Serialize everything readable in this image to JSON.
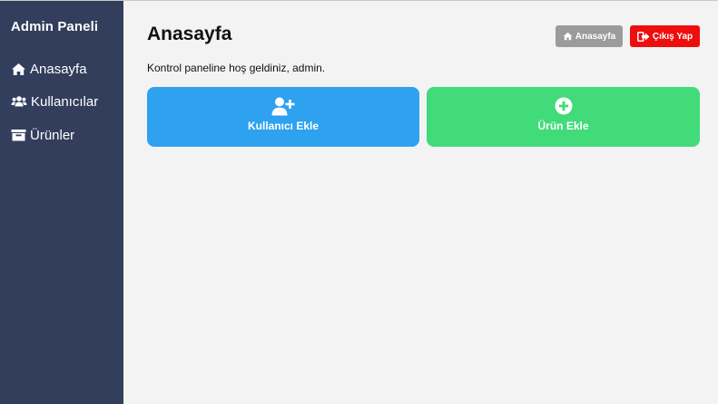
{
  "sidebar": {
    "brand": "Admin Paneli",
    "items": [
      {
        "label": "Anasayfa",
        "icon": "home-icon"
      },
      {
        "label": "Kullanıcılar",
        "icon": "users-icon"
      },
      {
        "label": "Ürünler",
        "icon": "box-icon"
      }
    ]
  },
  "header": {
    "title": "Anasayfa",
    "home_button": {
      "label": "Anasayfa",
      "icon": "home-icon"
    },
    "logout_button": {
      "label": "Çıkış Yap",
      "icon": "sign-out-icon"
    }
  },
  "main": {
    "welcome_text": "Kontrol paneline hoş geldiniz, admin.",
    "cards": [
      {
        "label": "Kullanıcı Ekle",
        "icon": "user-plus-icon"
      },
      {
        "label": "Ürün Ekle",
        "icon": "plus-circle-icon"
      }
    ]
  },
  "colors": {
    "sidebar_bg": "#323e5c",
    "page_bg": "#f3f3f3",
    "home_button_bg": "#9b9b9b",
    "logout_button_bg": "#ee0e0e",
    "add_user_card_bg": "#2ea1ef",
    "add_product_card_bg": "#41db79"
  }
}
